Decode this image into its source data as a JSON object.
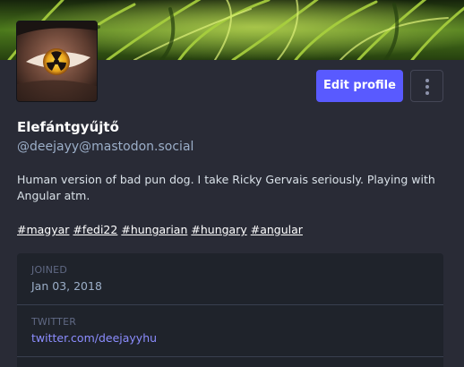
{
  "colors": {
    "page_background": "#292b36",
    "accent": "#595aff",
    "link": "#8c8dff",
    "muted_text": "#9baec8",
    "field_label": "#606984",
    "fields_background": "#1f232b"
  },
  "profile": {
    "banner_icon": "grass-header-image",
    "avatar_icon": "radioactive-eye-avatar",
    "display_name": "Elefántgyűjtő",
    "handle": "@deejayy@mastodon.social",
    "bio": "Human version of bad pun dog. I take Ricky Gervais seriously. Playing with Angular atm.",
    "hashtags": [
      "#magyar",
      "#fedi22",
      "#hungarian",
      "#hungary",
      "#angular"
    ]
  },
  "actions": {
    "edit_profile_label": "Edit profile",
    "more_icon": "vertical-ellipsis-icon"
  },
  "fields": [
    {
      "label": "Joined",
      "value": "Jan 03, 2018"
    },
    {
      "label": "Twitter",
      "value": "twitter.com/deejayyhu"
    }
  ]
}
